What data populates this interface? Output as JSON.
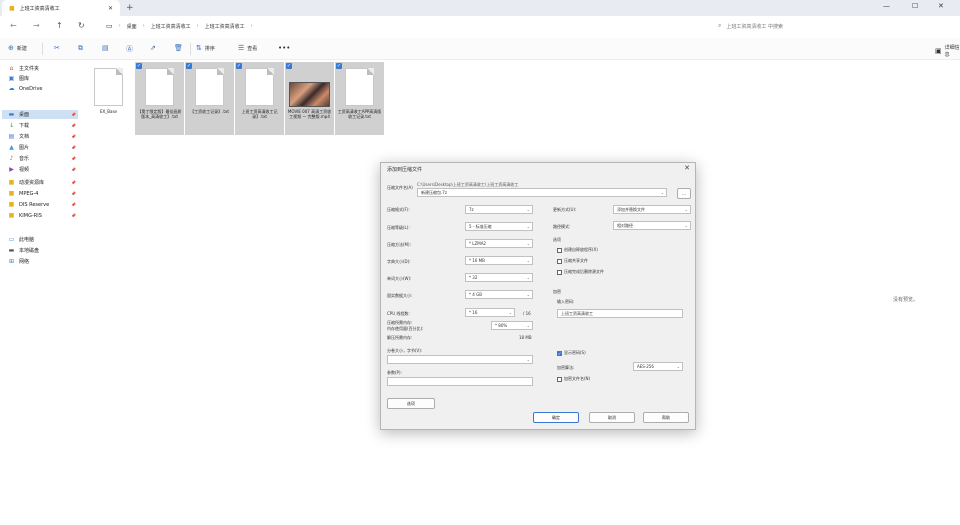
{
  "window": {
    "tab_title": "上班工资高清收工",
    "minimize": "—",
    "maximize": "☐",
    "close": "✕"
  },
  "address": {
    "crumbs": [
      "桌面",
      "上班工资高清收工",
      "上班工资高清收工"
    ],
    "search_placeholder": "上班工资高清收工 中搜索"
  },
  "toolbar": {
    "new_label": "新建",
    "sort_label": "排序",
    "view_label": "查看",
    "details_label": "详细信息"
  },
  "sidebar": {
    "items": [
      {
        "label": "主文件夹",
        "icon": "home-icon"
      },
      {
        "label": "图库",
        "icon": "gallery-icon"
      },
      {
        "label": "OneDrive",
        "icon": "cloud-icon"
      },
      {
        "label": "桌面",
        "icon": "desktop-icon"
      },
      {
        "label": "下载",
        "icon": "download-icon"
      },
      {
        "label": "文档",
        "icon": "document-icon"
      },
      {
        "label": "图片",
        "icon": "picture-icon"
      },
      {
        "label": "音乐",
        "icon": "music-icon"
      },
      {
        "label": "视频",
        "icon": "video-icon"
      },
      {
        "label": "动漫资源库",
        "icon": "folder-icon"
      },
      {
        "label": "MPEG-4",
        "icon": "folder-icon"
      },
      {
        "label": "DIS Reserve",
        "icon": "folder-icon"
      },
      {
        "label": "KIMG-RIS",
        "icon": "folder-icon"
      },
      {
        "label": "此电脑",
        "icon": "computer-icon"
      },
      {
        "label": "本地磁盘",
        "icon": "drive-icon"
      },
      {
        "label": "网络",
        "icon": "network-icon"
      }
    ]
  },
  "files": [
    {
      "name": "EX_Base",
      "selected": false,
      "type": "doc"
    },
    {
      "name": "【奥丁限定版】最佳画质版本_高清收工】.txt",
      "selected": true,
      "type": "doc"
    },
    {
      "name": "【工资收工记录】.txt",
      "selected": true,
      "type": "doc"
    },
    {
      "name": "上班工资高清收工记录】.txt",
      "selected": true,
      "type": "doc"
    },
    {
      "name": "MOVIE 007 高清工资收工视频 — 完整版.mp4",
      "selected": true,
      "type": "video"
    },
    {
      "name": "工资高清收工APP高清版收工记录.txt",
      "selected": true,
      "type": "doc"
    }
  ],
  "status_right": "没有预览。",
  "dialog": {
    "title": "添加到压缩文件",
    "archive_label": "压缩文件名(A)",
    "archive_path": "C:\\Users\\Desktop\\上班工资高清收工\\上班工资高清收工",
    "archive_name": "新建压缩包.7z",
    "browse": "...",
    "left_fields": [
      {
        "label": "压缩格式(F):",
        "value": "7z"
      },
      {
        "label": "压缩等级(L):",
        "value": "5 - 标准压缩"
      },
      {
        "label": "压缩方法(M):",
        "value": "* LZMA2"
      },
      {
        "label": "字典大小(D):",
        "value": "* 16 MB"
      },
      {
        "label": "单词大小(W):",
        "value": "* 32"
      },
      {
        "label": "固实数据大小:",
        "value": "* 4 GB"
      }
    ],
    "cpu_label": "CPU 线程数:",
    "cpu_value": "* 16",
    "cpu_total": "/ 16",
    "mem_label1": "压缩所需内存:",
    "mem_label2": "内存使用量(百分比):",
    "mem_value": "* 80%",
    "decomp_label": "解压所需内存:",
    "decomp_value": "18 MB",
    "split_label": "分卷大小，字节(V):",
    "params_label": "参数(P):",
    "options_btn": "选项",
    "right_fields": [
      {
        "label": "更新方式(U):",
        "value": "添加并替换文件"
      },
      {
        "label": "路径模式:",
        "value": "相对路径"
      }
    ],
    "options_title": "选项",
    "checkboxes": [
      {
        "label": "创建自释放程序(X)",
        "checked": false
      },
      {
        "label": "压缩共享文件",
        "checked": false
      },
      {
        "label": "压缩完成后删除源文件",
        "checked": false
      }
    ],
    "encrypt_title": "加密",
    "password_label": "输入密码:",
    "password_value": "上班工资高清收工",
    "show_password": {
      "label": "显示密码(S)",
      "checked": true
    },
    "enc_method_label": "加密算法:",
    "enc_method_value": "AES-256",
    "encrypt_names": {
      "label": "加密文件名(N)",
      "checked": false
    },
    "ok": "确定",
    "cancel": "取消",
    "help": "帮助"
  }
}
